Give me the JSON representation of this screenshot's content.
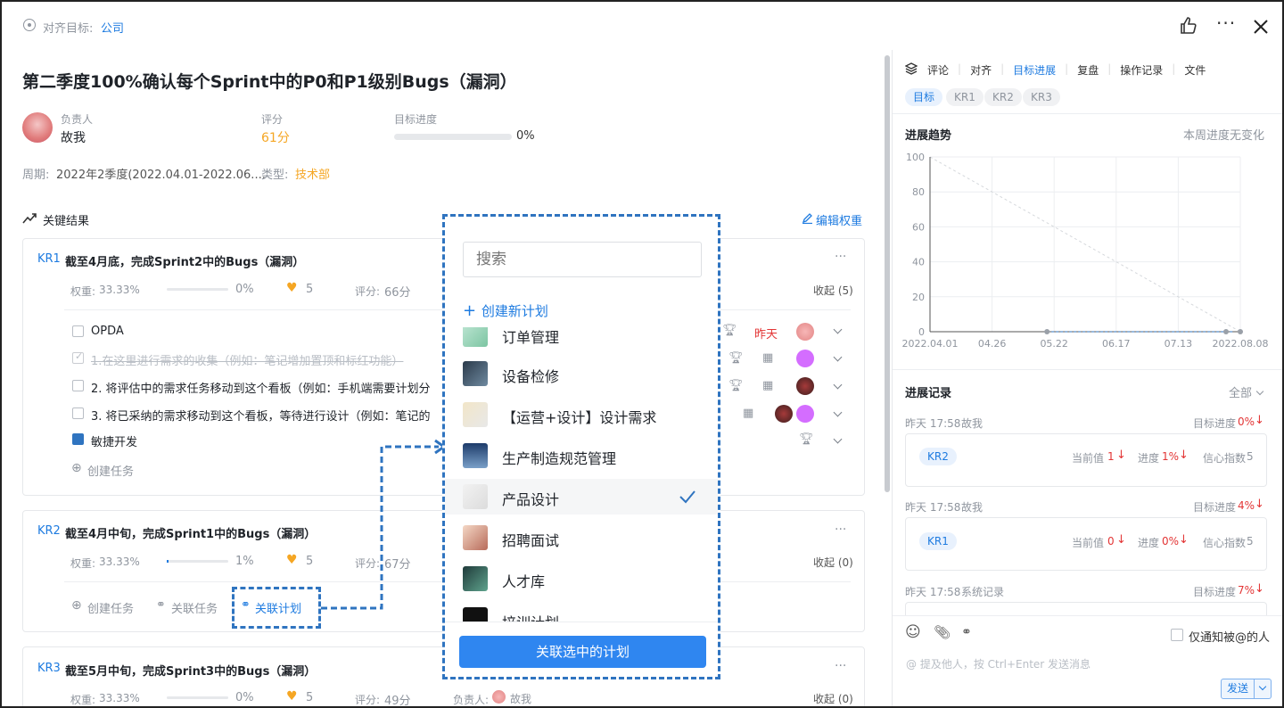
{
  "header": {
    "align_label": "对齐目标:",
    "align_value": "公司"
  },
  "objective": {
    "title": "第二季度100%确认每个Sprint中的P0和P1级别Bugs（漏洞）",
    "owner_label": "负责人",
    "owner_name": "故我",
    "score_label": "评分",
    "score_value": "61分",
    "progress_label": "目标进度",
    "progress_value": "0%",
    "progress": 0,
    "period_label": "周期:",
    "period_value": "2022年2季度(2022.04.01-2022.06....",
    "type_label": "类型:",
    "type_value": "技术部"
  },
  "kr_section": {
    "title": "关键结果",
    "edit_weight": "编辑权重"
  },
  "kr1": {
    "tag": "KR1",
    "title": "截至4月底，完成Sprint2中的Bugs（漏洞）",
    "weight_label": "权重:",
    "weight": "33.33%",
    "progress": "0%",
    "likes": "5",
    "score_label": "评分:",
    "score": "66分",
    "collapse": "收起 (5)",
    "tasks": [
      {
        "text": "OPDA",
        "due": "昨天"
      },
      {
        "text": "1.在这里进行需求的收集（例如：笔记增加置顶和标红功能）"
      },
      {
        "text": "2. 将评估中的需求任务移动到这个看板（例如：手机端需要计划分"
      },
      {
        "text": "3. 将已采纳的需求移动到这个看板，等待进行设计（例如：笔记的"
      }
    ],
    "board": "敏捷开发",
    "create_task": "创建任务"
  },
  "kr2": {
    "tag": "KR2",
    "title": "截至4月中旬，完成Sprint1中的Bugs（漏洞）",
    "weight_label": "权重:",
    "weight": "33.33%",
    "progress": "1%",
    "likes": "5",
    "score_label": "评分:",
    "score": "67分",
    "collapse": "收起 (0)",
    "create_task": "创建任务",
    "link_task": "关联任务",
    "link_plan": "关联计划"
  },
  "kr3": {
    "tag": "KR3",
    "title": "截至5月中旬，完成Sprint3中的Bugs（漏洞）",
    "weight_label": "权重:",
    "weight": "33.33%",
    "progress": "0%",
    "likes": "5",
    "score_label": "评分:",
    "score": "49分",
    "owner_label": "负责人:",
    "owner": "故我",
    "collapse": "收起 (0)"
  },
  "dropdown": {
    "search_placeholder": "搜索",
    "create_plan": "创建新计划",
    "partial_top": "订单管理",
    "items": [
      "设备检修",
      "【运营+设计】设计需求",
      "生产制造规范管理",
      "产品设计",
      "招聘面试",
      "人才库"
    ],
    "partial_bottom": "培训计划",
    "submit": "关联选中的计划"
  },
  "right": {
    "tabs": [
      "评论",
      "对齐",
      "目标进展",
      "复盘",
      "操作记录",
      "文件"
    ],
    "active_tab": "目标进展",
    "filters": [
      "目标",
      "KR1",
      "KR2",
      "KR3"
    ],
    "trend_title": "进展趋势",
    "trend_note": "本周进度无变化",
    "records_title": "进展记录",
    "records_filter": "全部",
    "records": [
      {
        "time": "昨天 17:58",
        "who": "故我",
        "progress_label": "目标进度",
        "progress": "0%",
        "kr": "KR2",
        "cur_label": "当前值",
        "cur": "1",
        "prog_label": "进度",
        "prog": "1%",
        "conf_label": "信心指数",
        "conf": "5"
      },
      {
        "time": "昨天 17:58",
        "who": "故我",
        "progress_label": "目标进度",
        "progress": "4%",
        "kr": "KR1",
        "cur_label": "当前值",
        "cur": "0",
        "prog_label": "进度",
        "prog": "0%",
        "conf_label": "信心指数",
        "conf": "5"
      },
      {
        "time": "昨天 17:58",
        "who": "系统记录",
        "progress_label": "目标进度",
        "progress": "7%"
      }
    ],
    "notify_label": "仅通知被@的人",
    "input_hint": "@ 提及他人，按 Ctrl+Enter 发送消息",
    "send": "发送"
  },
  "chart_data": {
    "type": "line",
    "x": [
      "2022.04.01",
      "04.26",
      "05.22",
      "06.17",
      "07.13",
      "2022.08.08"
    ],
    "y_ticks": [
      0,
      20,
      40,
      60,
      80,
      100
    ],
    "ylim": [
      0,
      100
    ],
    "series": [
      {
        "values": [
          0,
          0,
          0,
          0,
          0,
          0
        ]
      }
    ],
    "grid": true
  }
}
